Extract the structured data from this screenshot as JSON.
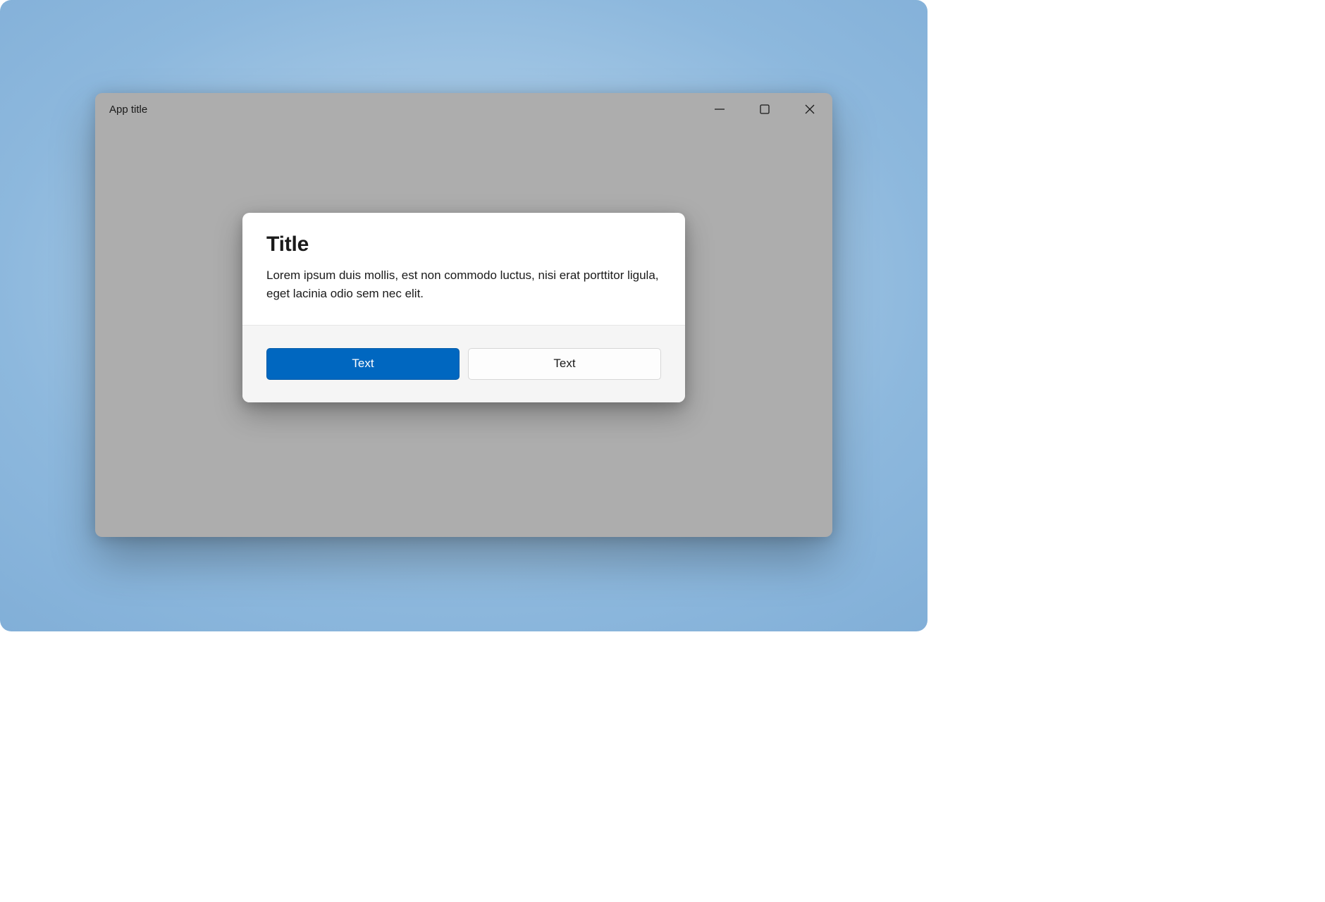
{
  "window": {
    "app_title": "App title"
  },
  "dialog": {
    "title": "Title",
    "body": "Lorem ipsum duis mollis, est non commodo luctus, nisi erat porttitor ligula, eget lacinia odio sem nec elit.",
    "primary_label": "Text",
    "secondary_label": "Text"
  },
  "colors": {
    "accent": "#0067c0",
    "window_dim": "#adadad",
    "dialog_footer": "#f5f5f5"
  }
}
